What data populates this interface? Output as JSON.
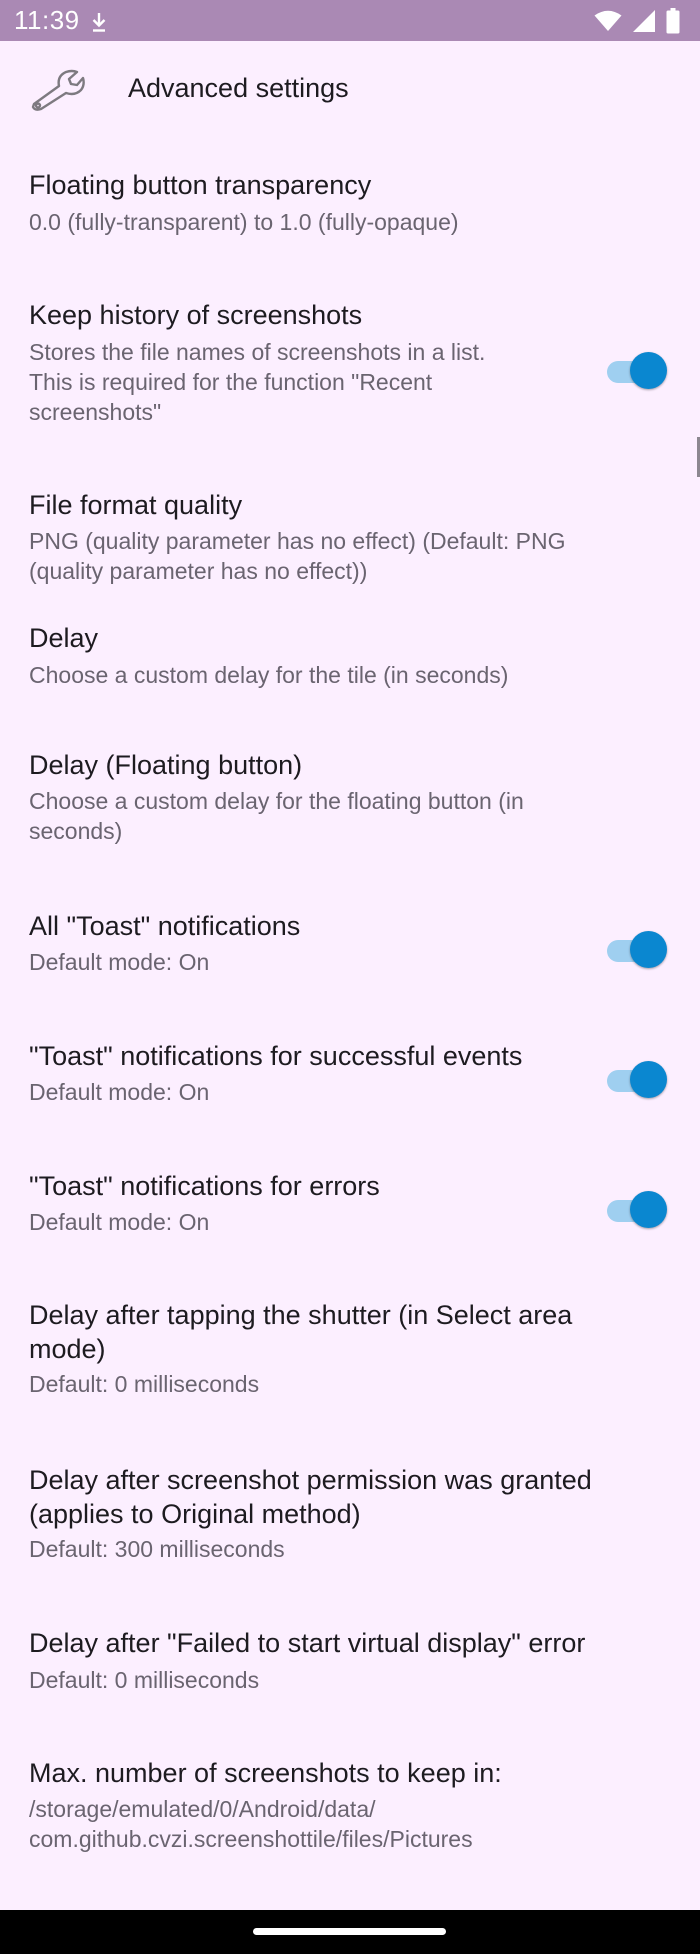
{
  "status_bar": {
    "time": "11:39",
    "icons": [
      "download-icon",
      "wifi-icon",
      "signal-icon",
      "battery-icon"
    ],
    "bg_color": "#aa89b4"
  },
  "header": {
    "title": "Advanced settings",
    "icon": "wrench-icon"
  },
  "accent_color": "#0a87d0",
  "settings": [
    {
      "title": "Floating button transparency",
      "summary": "0.0 (fully-transparent) to 1.0 (fully-opaque)",
      "has_toggle": false
    },
    {
      "title": "Keep history of screenshots",
      "summary": "Stores the file names of screenshots in a list. This is required for the function \"Recent screenshots\"",
      "has_toggle": true,
      "toggle_on": true
    },
    {
      "title": "File format quality",
      "summary": "PNG (quality parameter has no effect) (Default: PNG (quality parameter has no effect))",
      "has_toggle": false
    },
    {
      "title": "Delay",
      "summary": "Choose a custom delay for the tile (in seconds)",
      "has_toggle": false
    },
    {
      "title": "Delay (Floating button)",
      "summary": "Choose a custom delay for the floating button (in seconds)",
      "has_toggle": false
    },
    {
      "title": "All \"Toast\" notifications",
      "summary": "Default mode: On",
      "has_toggle": true,
      "toggle_on": true
    },
    {
      "title": "\"Toast\" notifications for successful events",
      "summary": "Default mode: On",
      "has_toggle": true,
      "toggle_on": true
    },
    {
      "title": "\"Toast\" notifications for errors",
      "summary": "Default mode: On",
      "has_toggle": true,
      "toggle_on": true
    },
    {
      "title": "Delay after tapping the shutter (in Select area mode)",
      "summary": "Default: 0 milliseconds",
      "has_toggle": false
    },
    {
      "title": "Delay after screenshot permission was granted (applies to Original method)",
      "summary": "Default: 300 milliseconds",
      "has_toggle": false
    },
    {
      "title": "Delay after \"Failed to start virtual display\" error",
      "summary": "Default: 0 milliseconds",
      "has_toggle": false
    },
    {
      "title": "Max. number of screenshots to keep in:",
      "summary": "/storage/emulated/0/Android/data/\ncom.github.cvzi.screenshottile/files/Pictures",
      "has_toggle": false
    }
  ]
}
